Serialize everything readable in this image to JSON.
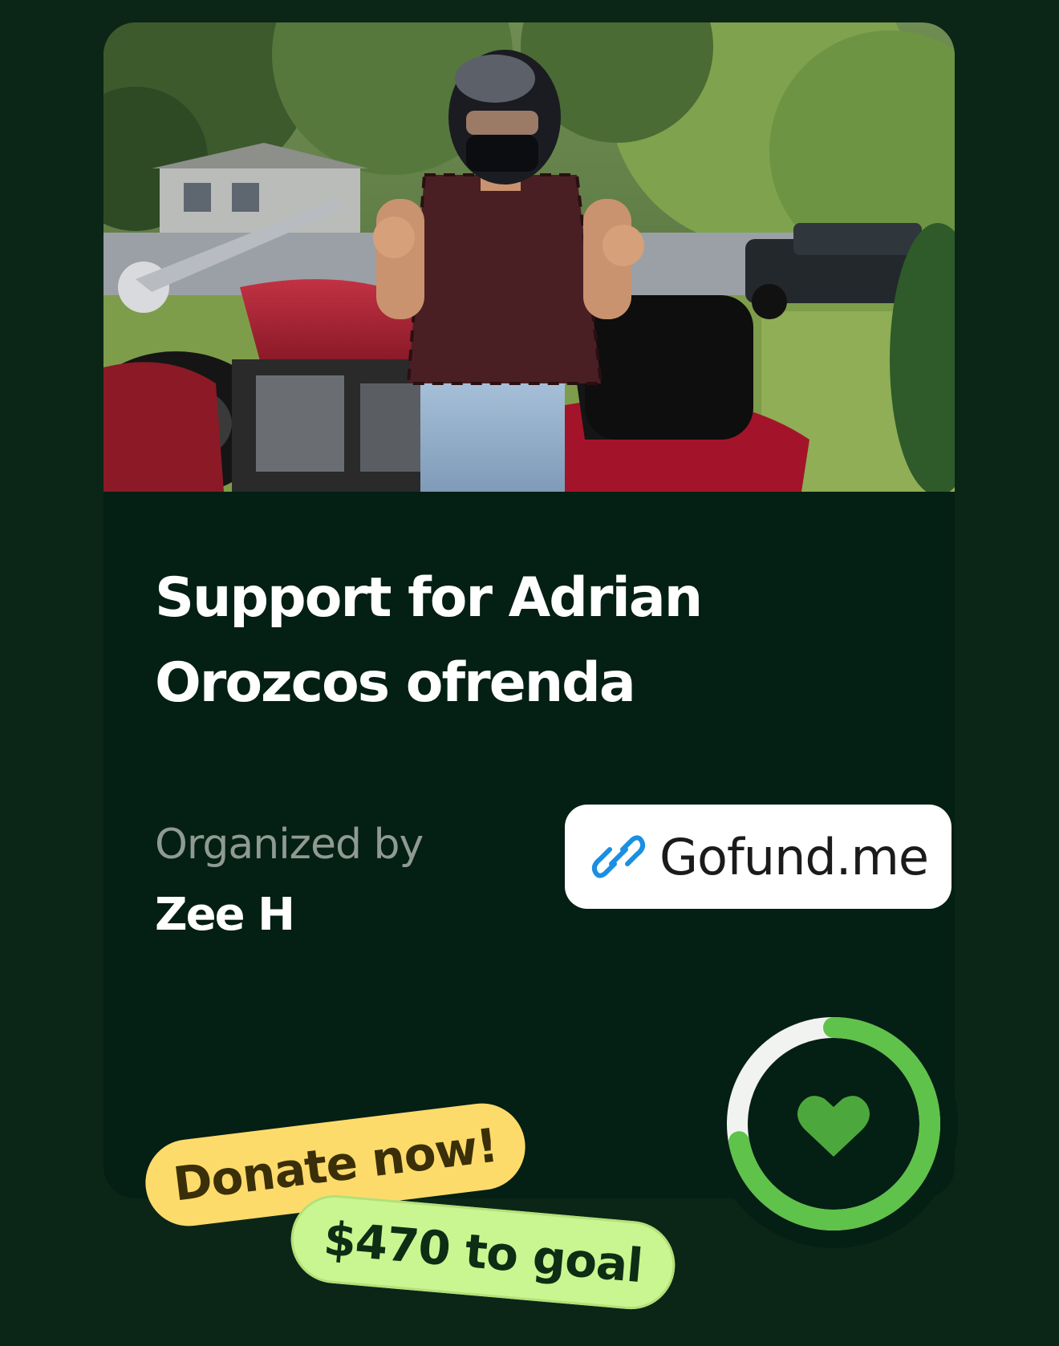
{
  "campaign": {
    "title": "Support for Adrian Orozcos ofrenda",
    "organized_label": "Organized by",
    "organizer": "Zee H",
    "link_label": "Gofund.me",
    "link_icon": "link-icon",
    "donate_label": "Donate now!",
    "goal_label": "$470 to goal",
    "progress_icon": "heart-icon",
    "progress_fraction": 0.72
  },
  "colors": {
    "background": "#0b2617",
    "card": "#041f13",
    "accent_green": "#5fc24a",
    "donate_tag": "#fddb6b",
    "goal_tag": "#c9f690",
    "link_blue": "#1a8fe3"
  }
}
